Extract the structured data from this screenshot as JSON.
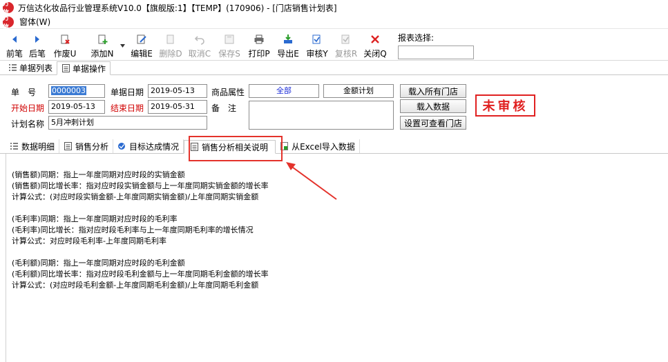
{
  "window": {
    "title": "万信达化妆品行业管理系统V10.0【旗舰版:1】【TEMP】(170906) - [门店销售计划表]",
    "logo_text": "万信"
  },
  "menu": {
    "window_label": "窗体(W)"
  },
  "toolbar": {
    "buttons": [
      {
        "label": "前笔",
        "icon": "arrow-left-icon",
        "enabled": true
      },
      {
        "label": "后笔",
        "icon": "arrow-right-icon",
        "enabled": true
      },
      {
        "label": "作废U",
        "icon": "void-doc-icon",
        "enabled": true
      },
      {
        "label": "添加N",
        "icon": "add-doc-icon",
        "enabled": true
      },
      {
        "label": "编辑E",
        "icon": "edit-icon",
        "enabled": true
      },
      {
        "label": "删除D",
        "icon": "delete-doc-icon",
        "enabled": false
      },
      {
        "label": "取消C",
        "icon": "undo-icon",
        "enabled": false
      },
      {
        "label": "保存S",
        "icon": "save-icon",
        "enabled": false
      },
      {
        "label": "打印P",
        "icon": "printer-icon",
        "enabled": true
      },
      {
        "label": "导出E",
        "icon": "export-icon",
        "enabled": true
      },
      {
        "label": "审核Y",
        "icon": "approve-icon",
        "enabled": true
      },
      {
        "label": "复核R",
        "icon": "review-icon",
        "enabled": false
      },
      {
        "label": "关闭Q",
        "icon": "close-x-icon",
        "enabled": true
      }
    ],
    "report_select_label": "报表选择:",
    "report_select_value": ""
  },
  "doc_tabs": [
    {
      "label": "单据列表",
      "active": false
    },
    {
      "label": "单据操作",
      "active": true
    }
  ],
  "form": {
    "doc_no_label": "单　号",
    "doc_no_value": "0000003",
    "doc_date_label": "单据日期",
    "doc_date_value": "2019-05-13",
    "product_attr_label": "商品属性",
    "product_attr_value": "全部",
    "amount_plan_value": "金额计划",
    "load_all_stores_button": "载入所有门店",
    "start_date_label": "开始日期",
    "start_date_value": "2019-05-13",
    "end_date_label": "结束日期",
    "end_date_value": "2019-05-31",
    "remark_label": "备　注",
    "remark_value": "",
    "load_data_button": "载入数据",
    "plan_name_label": "计划名称",
    "plan_name_value": "5月冲刺计划",
    "set_visible_stores_button": "设置可查看门店",
    "status_stamp": "未审核"
  },
  "sub_tabs": [
    {
      "label": "数据明细",
      "active": false
    },
    {
      "label": "销售分析",
      "active": false
    },
    {
      "label": "目标达成情况",
      "active": false
    },
    {
      "label": "销售分析相关说明",
      "active": true
    },
    {
      "label": "从Excel导入数据",
      "active": false
    }
  ],
  "content_lines": [
    "(销售额)同期：指上一年度同期对应时段的实销金额",
    "(销售额)同比增长率：指对应时段实销金额与上一年度同期实销金额的增长率",
    "计算公式：(对应时段实销金额-上年度同期实销金额)/上年度同期实销金额",
    "(毛利率)同期：指上一年度同期对应时段的毛利率",
    "(毛利率)同比增长：指对应时段毛利率与上一年度同期毛利率的增长情况",
    "计算公式：对应时段毛利率-上年度同期毛利率",
    "(毛利额)同期：指上一年度同期对应时段的毛利金额",
    "(毛利额)同比增长率：指对应时段毛利金额与上一年度同期毛利金额的增长率",
    "计算公式：(对应时段毛利金额-上年度同期毛利金额)/上年度同期毛利金额"
  ],
  "colors": {
    "red_label": "#d00000",
    "stamp": "#e02020",
    "highlight": "#e4322b",
    "selection": "#3b7bd4",
    "attr_text": "#1a2bd8"
  }
}
